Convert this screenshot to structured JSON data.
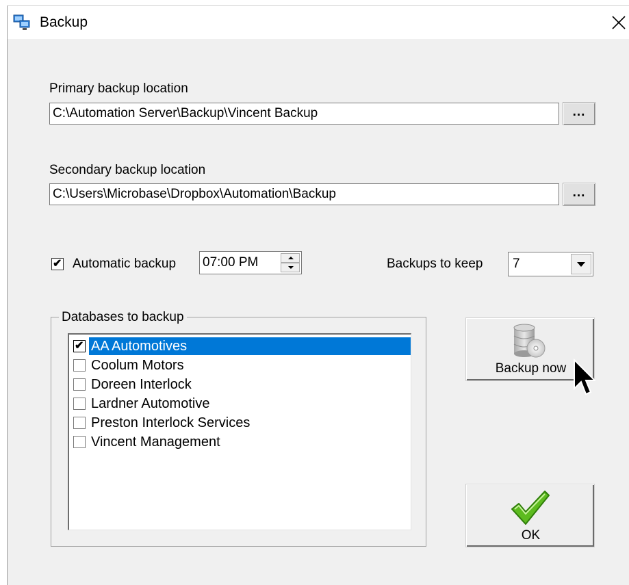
{
  "window": {
    "title": "Backup",
    "app_icon": "network-computers-icon",
    "close_icon": "close-icon"
  },
  "primary": {
    "label": "Primary backup location",
    "value": "C:\\Automation Server\\Backup\\Vincent Backup",
    "browse_label": "..."
  },
  "secondary": {
    "label": "Secondary backup location",
    "value": "C:\\Users\\Microbase\\Dropbox\\Automation\\Backup",
    "browse_label": "..."
  },
  "automatic": {
    "checked": true,
    "label": "Automatic backup",
    "time": "07:00 PM"
  },
  "keep": {
    "label": "Backups to keep",
    "value": "7"
  },
  "databases": {
    "legend": "Databases to backup",
    "items": [
      {
        "label": "AA Automotives",
        "checked": true,
        "selected": true
      },
      {
        "label": "Coolum Motors",
        "checked": false,
        "selected": false
      },
      {
        "label": "Doreen Interlock",
        "checked": false,
        "selected": false
      },
      {
        "label": "Lardner Automotive",
        "checked": false,
        "selected": false
      },
      {
        "label": "Preston Interlock Services",
        "checked": false,
        "selected": false
      },
      {
        "label": "Vincent Management",
        "checked": false,
        "selected": false
      }
    ]
  },
  "backup_now": {
    "label": "Backup now",
    "icon": "database-disc-icon"
  },
  "ok": {
    "label": "OK",
    "icon": "green-checkmark-icon"
  },
  "colors": {
    "selection": "#0078d7",
    "check_green": "#4caf1a"
  }
}
